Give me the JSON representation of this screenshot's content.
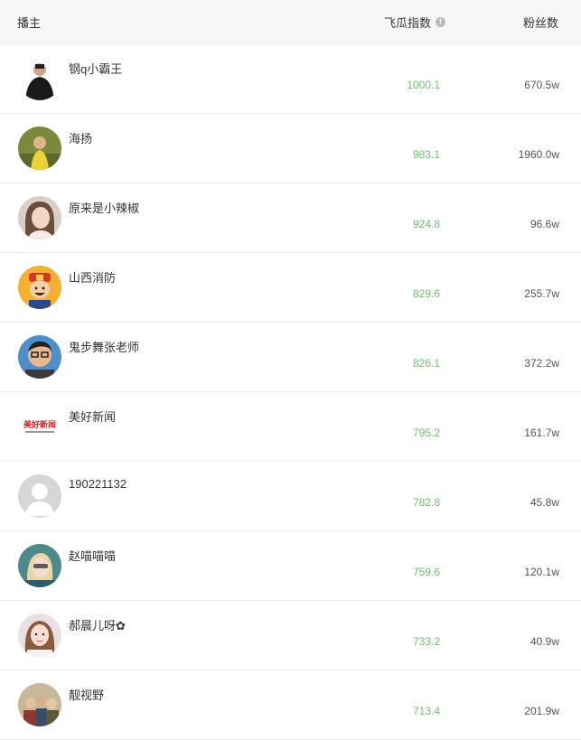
{
  "header": {
    "anchor_label": "播主",
    "index_label": "飞瓜指数",
    "fans_label": "粉丝数",
    "info_icon": "info-icon"
  },
  "rows": [
    {
      "name": "钢q小霸王",
      "index": "1000.1",
      "fans": "670.5w",
      "avatar": "man-dark-suit"
    },
    {
      "name": "海扬",
      "index": "983.1",
      "fans": "1960.0w",
      "avatar": "child-yellow-outdoor"
    },
    {
      "name": "原来是小辣椒",
      "index": "924.8",
      "fans": "96.6w",
      "avatar": "woman-portrait"
    },
    {
      "name": "山西消防",
      "index": "829.6",
      "fans": "255.7w",
      "avatar": "cartoon-firefighter"
    },
    {
      "name": "鬼步舞张老师",
      "index": "826.1",
      "fans": "372.2w",
      "avatar": "man-glasses"
    },
    {
      "name": "美好新闻",
      "index": "795.2",
      "fans": "161.7w",
      "avatar": "news-logo",
      "avatar_text": "美好新闻"
    },
    {
      "name": "190221132",
      "index": "782.8",
      "fans": "45.8w",
      "avatar": "default-user"
    },
    {
      "name": "赵喵喵喵",
      "index": "759.6",
      "fans": "120.1w",
      "avatar": "blonde-woman"
    },
    {
      "name": "郝晨儿呀✿",
      "index": "733.2",
      "fans": "40.9w",
      "avatar": "woman-selfie"
    },
    {
      "name": "靓视野",
      "index": "713.4",
      "fans": "201.9w",
      "avatar": "group-photo"
    }
  ],
  "colors": {
    "index": "#6cc06c",
    "header_bg": "#f7f7f7",
    "divider": "#ececec"
  }
}
